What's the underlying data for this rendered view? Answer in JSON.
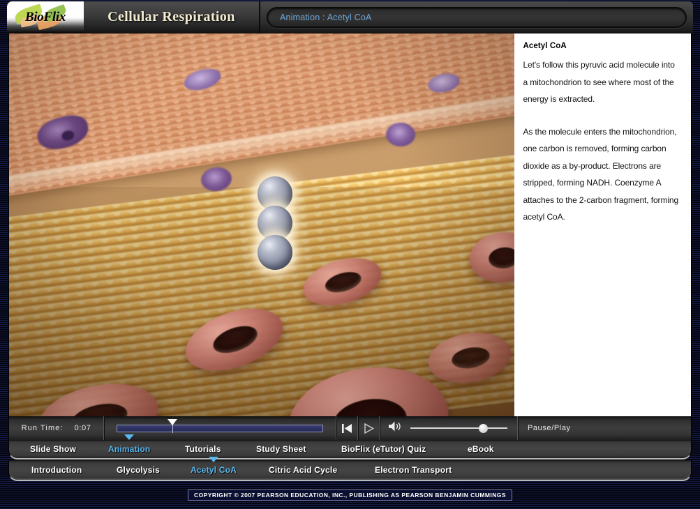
{
  "window": {
    "brand": "BioFlix",
    "title": "Cellular Respiration",
    "address": "Animation : Acetyl CoA"
  },
  "text_panel": {
    "heading": "Acetyl CoA",
    "paragraphs": [
      "Let's follow this pyruvic acid molecule into a mitochondrion to see where most of the energy is extracted.",
      "As the molecule enters the mitochondrion, one carbon is removed, forming carbon dioxide as a by-product. Electrons are stripped, forming NADH. Coenzyme A attaches to the 2-carbon fragment, forming acetyl CoA."
    ]
  },
  "controls": {
    "runtime_label": "Run Time:",
    "runtime_value": "0:07",
    "scrub_percent": 27,
    "volume_percent": 75,
    "rewind_icon": "skip-to-start-icon",
    "play_icon": "play-icon",
    "volume_icon": "speaker-icon",
    "pause_play_label": "Pause/Play"
  },
  "nav_primary": {
    "items": [
      {
        "label": "Slide Show",
        "active": false
      },
      {
        "label": "Animation",
        "active": true
      },
      {
        "label": "Tutorials",
        "active": false
      },
      {
        "label": "Study Sheet",
        "active": false
      },
      {
        "label": "BioFlix (eTutor) Quiz",
        "active": false
      },
      {
        "label": "eBook",
        "active": false
      }
    ]
  },
  "nav_secondary": {
    "items": [
      {
        "label": "Introduction",
        "active": false
      },
      {
        "label": "Glycolysis",
        "active": false
      },
      {
        "label": "Acetyl CoA",
        "active": true
      },
      {
        "label": "Citric Acid Cycle",
        "active": false
      },
      {
        "label": "Electron Transport",
        "active": false
      }
    ]
  },
  "footer": {
    "copyright": "COPYRIGHT © 2007 PEARSON EDUCATION, INC., PUBLISHING AS PEARSON BENJAMIN CUMMINGS"
  },
  "colors": {
    "accent_cyan": "#59b7ee",
    "address_blue": "#6ea6d8",
    "title_cream": "#f3ecd2",
    "backdrop_navy": "#0b0d22",
    "scrub_blue": "#2c3160"
  }
}
